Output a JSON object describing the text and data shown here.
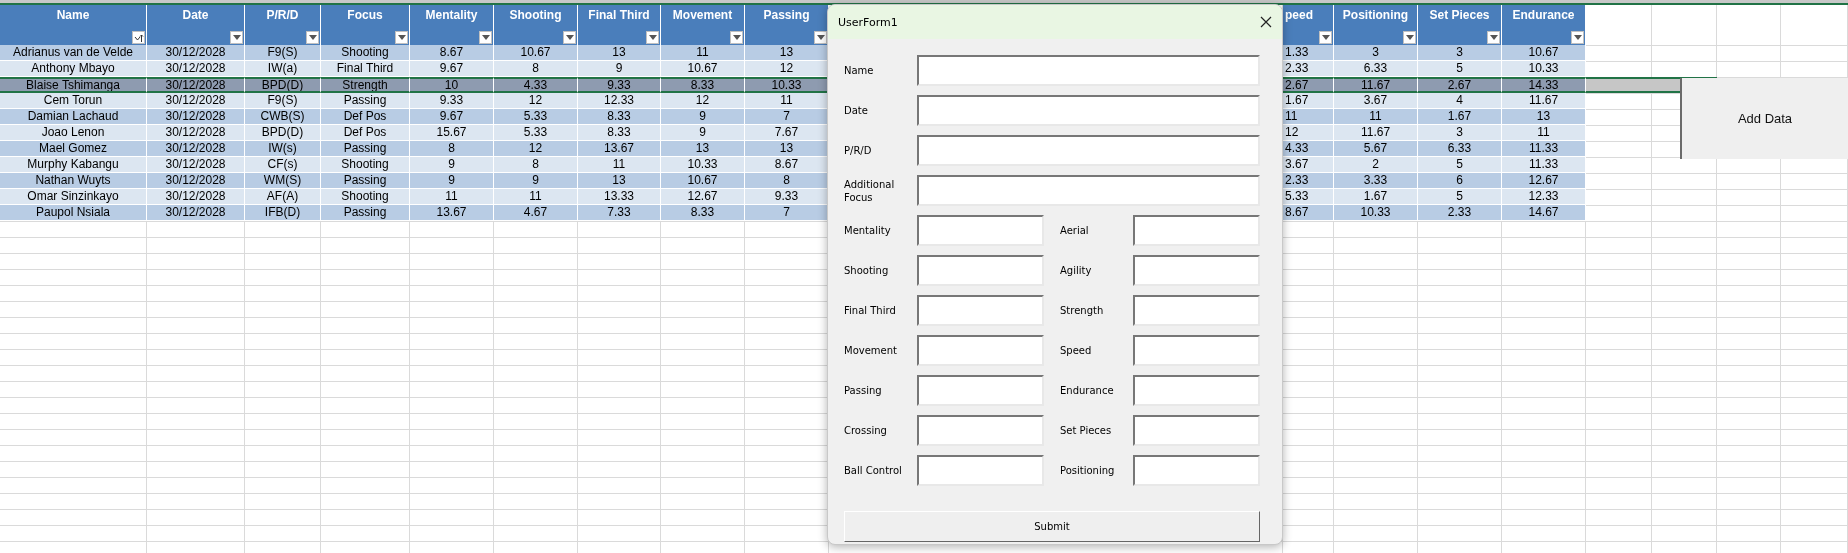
{
  "sheet": {
    "columns": [
      {
        "label": "Name",
        "kind": "sort",
        "clipped": false
      },
      {
        "label": "Date",
        "kind": "filter",
        "clipped": false
      },
      {
        "label": "P/R/D",
        "kind": "filter",
        "clipped": false
      },
      {
        "label": "Focus",
        "kind": "filter",
        "clipped": false
      },
      {
        "label": "Mentality",
        "kind": "filter",
        "clipped": false
      },
      {
        "label": "Shooting",
        "kind": "filter",
        "clipped": false
      },
      {
        "label": "Final Third",
        "kind": "filter",
        "clipped": false
      },
      {
        "label": "Movement",
        "kind": "filter",
        "clipped": false
      },
      {
        "label": "Passing",
        "kind": "filter",
        "clipped": false
      },
      {
        "label": "peed",
        "kind": "filter",
        "clipped": true
      },
      {
        "label": "Positioning",
        "kind": "filter",
        "clipped": false
      },
      {
        "label": "Set Pieces",
        "kind": "filter",
        "clipped": false
      },
      {
        "label": "Endurance",
        "kind": "filter",
        "clipped": false
      }
    ],
    "rows": [
      {
        "selected": false,
        "cells": [
          "Adrianus van de Velde",
          "30/12/2028",
          "F9(S)",
          "Shooting",
          "8.67",
          "10.67",
          "13",
          "11",
          "13",
          "1.33",
          "3",
          "3",
          "10.67"
        ]
      },
      {
        "selected": false,
        "cells": [
          "Anthony Mbayo",
          "30/12/2028",
          "IW(a)",
          "Final Third",
          "9.67",
          "8",
          "9",
          "10.67",
          "12",
          "2.33",
          "6.33",
          "5",
          "10.33"
        ]
      },
      {
        "selected": true,
        "cells": [
          "Blaise Tshimanga",
          "30/12/2028",
          "BPD(D)",
          "Strength",
          "10",
          "4.33",
          "9.33",
          "8.33",
          "10.33",
          "2.67",
          "11.67",
          "2.67",
          "14.33"
        ]
      },
      {
        "selected": false,
        "cells": [
          "Cem Torun",
          "30/12/2028",
          "F9(S)",
          "Passing",
          "9.33",
          "12",
          "12.33",
          "12",
          "11",
          "1.67",
          "3.67",
          "4",
          "11.67"
        ]
      },
      {
        "selected": false,
        "cells": [
          "Damian Lachaud",
          "30/12/2028",
          "CWB(S)",
          "Def Pos",
          "9.67",
          "5.33",
          "8.33",
          "9",
          "7",
          "11",
          "11",
          "1.67",
          "13"
        ]
      },
      {
        "selected": false,
        "cells": [
          "Joao Lenon",
          "30/12/2028",
          "BPD(D)",
          "Def Pos",
          "15.67",
          "5.33",
          "8.33",
          "9",
          "7.67",
          "12",
          "11.67",
          "3",
          "11"
        ]
      },
      {
        "selected": false,
        "cells": [
          "Mael Gomez",
          "30/12/2028",
          "IW(s)",
          "Passing",
          "8",
          "12",
          "13.67",
          "13",
          "13",
          "4.33",
          "5.67",
          "6.33",
          "11.33"
        ]
      },
      {
        "selected": false,
        "cells": [
          "Murphy Kabangu",
          "30/12/2028",
          "CF(s)",
          "Shooting",
          "9",
          "8",
          "11",
          "10.33",
          "8.67",
          "3.67",
          "2",
          "5",
          "11.33"
        ]
      },
      {
        "selected": false,
        "cells": [
          "Nathan Wuyts",
          "30/12/2028",
          "WM(S)",
          "Passing",
          "9",
          "9",
          "13",
          "10.67",
          "8",
          "2.33",
          "3.33",
          "6",
          "12.67"
        ]
      },
      {
        "selected": false,
        "cells": [
          "Omar Sinzinkayo",
          "30/12/2028",
          "AF(A)",
          "Shooting",
          "11",
          "11",
          "13.33",
          "12.67",
          "9.33",
          "5.33",
          "1.67",
          "5",
          "12.33"
        ]
      },
      {
        "selected": false,
        "cells": [
          "Paupol Nsiala",
          "30/12/2028",
          "IFB(D)",
          "Passing",
          "13.67",
          "4.67",
          "7.33",
          "8.33",
          "7",
          "8.67",
          "10.33",
          "2.33",
          "14.67"
        ]
      }
    ],
    "add_data_button": "Add Data"
  },
  "userform": {
    "title": "UserForm1",
    "wide_fields": [
      {
        "label": "Name"
      },
      {
        "label": "Date"
      },
      {
        "label": "P/R/D"
      },
      {
        "label": "Additional Focus"
      }
    ],
    "stat_rows": [
      {
        "left": "Mentality",
        "right": "Aerial"
      },
      {
        "left": "Shooting",
        "right": "Agility"
      },
      {
        "left": "Final Third",
        "right": "Strength"
      },
      {
        "left": "Movement",
        "right": "Speed"
      },
      {
        "left": "Passing",
        "right": "Endurance"
      },
      {
        "left": "Crossing",
        "right": "Set Pieces"
      },
      {
        "left": "Ball Control",
        "right": "Positioning"
      }
    ],
    "submit_button": "Submit"
  }
}
